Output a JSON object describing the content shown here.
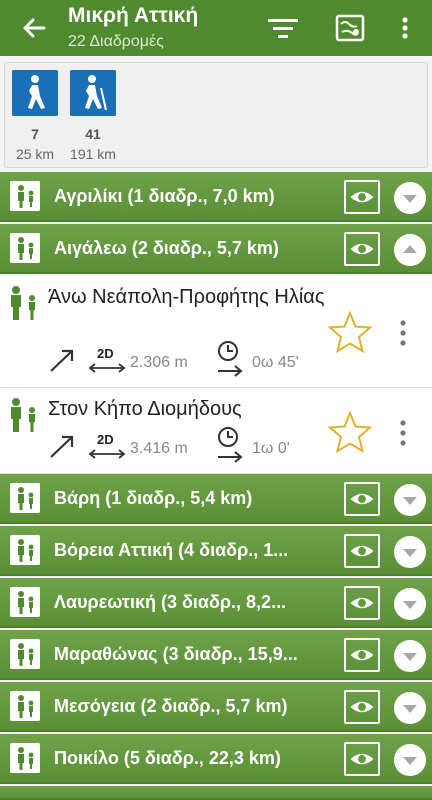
{
  "header": {
    "title": "Μικρή Αττική",
    "subtitle": "22 Διαδρομές"
  },
  "summary": [
    {
      "icon": "hiking-icon",
      "count": "7",
      "distance": "25 km"
    },
    {
      "icon": "hiking-poles-icon",
      "count": "41",
      "distance": "191 km"
    }
  ],
  "groups": [
    {
      "label": "Αγριλίκι (1 διαδρ., 7,0 km)",
      "expanded": false
    },
    {
      "label": "Αιγάλεω (2 διαδρ., 5,7 km)",
      "expanded": true
    },
    {
      "label": "Βάρη (1 διαδρ., 5,4 km)",
      "expanded": false
    },
    {
      "label": "Βόρεια Αττική (4 διαδρ., 1...",
      "expanded": false
    },
    {
      "label": "Λαυρεωτική (3 διαδρ., 8,2...",
      "expanded": false
    },
    {
      "label": "Μαραθώνας (3 διαδρ., 15,9...",
      "expanded": false
    },
    {
      "label": "Μεσόγεια (2 διαδρ., 5,7 km)",
      "expanded": false
    },
    {
      "label": "Ποικίλο (5 διαδρ., 22,3 km)",
      "expanded": false
    }
  ],
  "routes": [
    {
      "name": "Άνω Νεάπολη-Προφήτης Ηλίας",
      "dim": "2D",
      "distance": "2.306 m",
      "time": "0ω 45'"
    },
    {
      "name": "Στον Κήπο Διομήδους",
      "dim": "2D",
      "distance": "3.416 m",
      "time": "1ω 0'"
    }
  ],
  "colors": {
    "bar": "#4f8a2f",
    "group": "#5f9a3d",
    "activity_icon": "#1a6fb6",
    "star": "#e0b030"
  }
}
